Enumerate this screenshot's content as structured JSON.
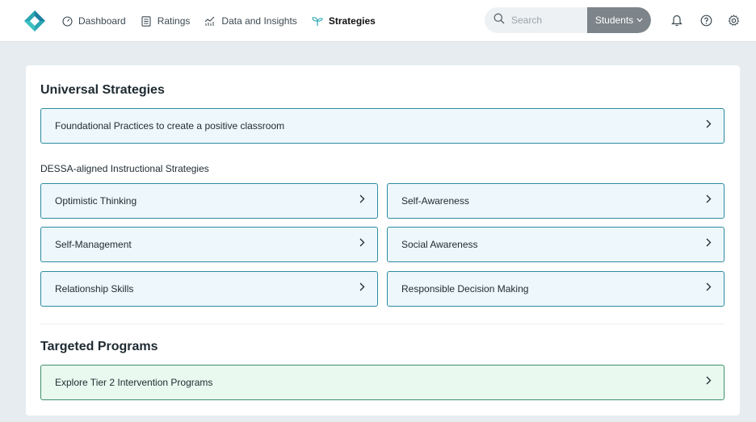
{
  "nav": {
    "items": [
      {
        "label": "Dashboard",
        "icon": "gauge-icon"
      },
      {
        "label": "Ratings",
        "icon": "document-icon"
      },
      {
        "label": "Data and Insights",
        "icon": "chart-icon"
      },
      {
        "label": "Strategies",
        "icon": "sprout-icon",
        "active": true
      }
    ]
  },
  "search": {
    "placeholder": "Search",
    "scope": "Students"
  },
  "colors": {
    "accent": "#2aa6b3",
    "tile_border": "#2c8ca0",
    "tile_bg": "#eef7fb",
    "green_tile_bg": "#eaf9ef",
    "scope_bg": "#7d858a"
  },
  "universal": {
    "title": "Universal Strategies",
    "foundational": "Foundational Practices to create a positive classroom",
    "aligned_label": "DESSA-aligned Instructional Strategies",
    "strategies": [
      "Optimistic Thinking",
      "Self-Awareness",
      "Self-Management",
      "Social Awareness",
      "Relationship Skills",
      "Responsible Decision Making"
    ]
  },
  "targeted": {
    "title": "Targeted Programs",
    "program": "Explore Tier 2 Intervention Programs"
  }
}
